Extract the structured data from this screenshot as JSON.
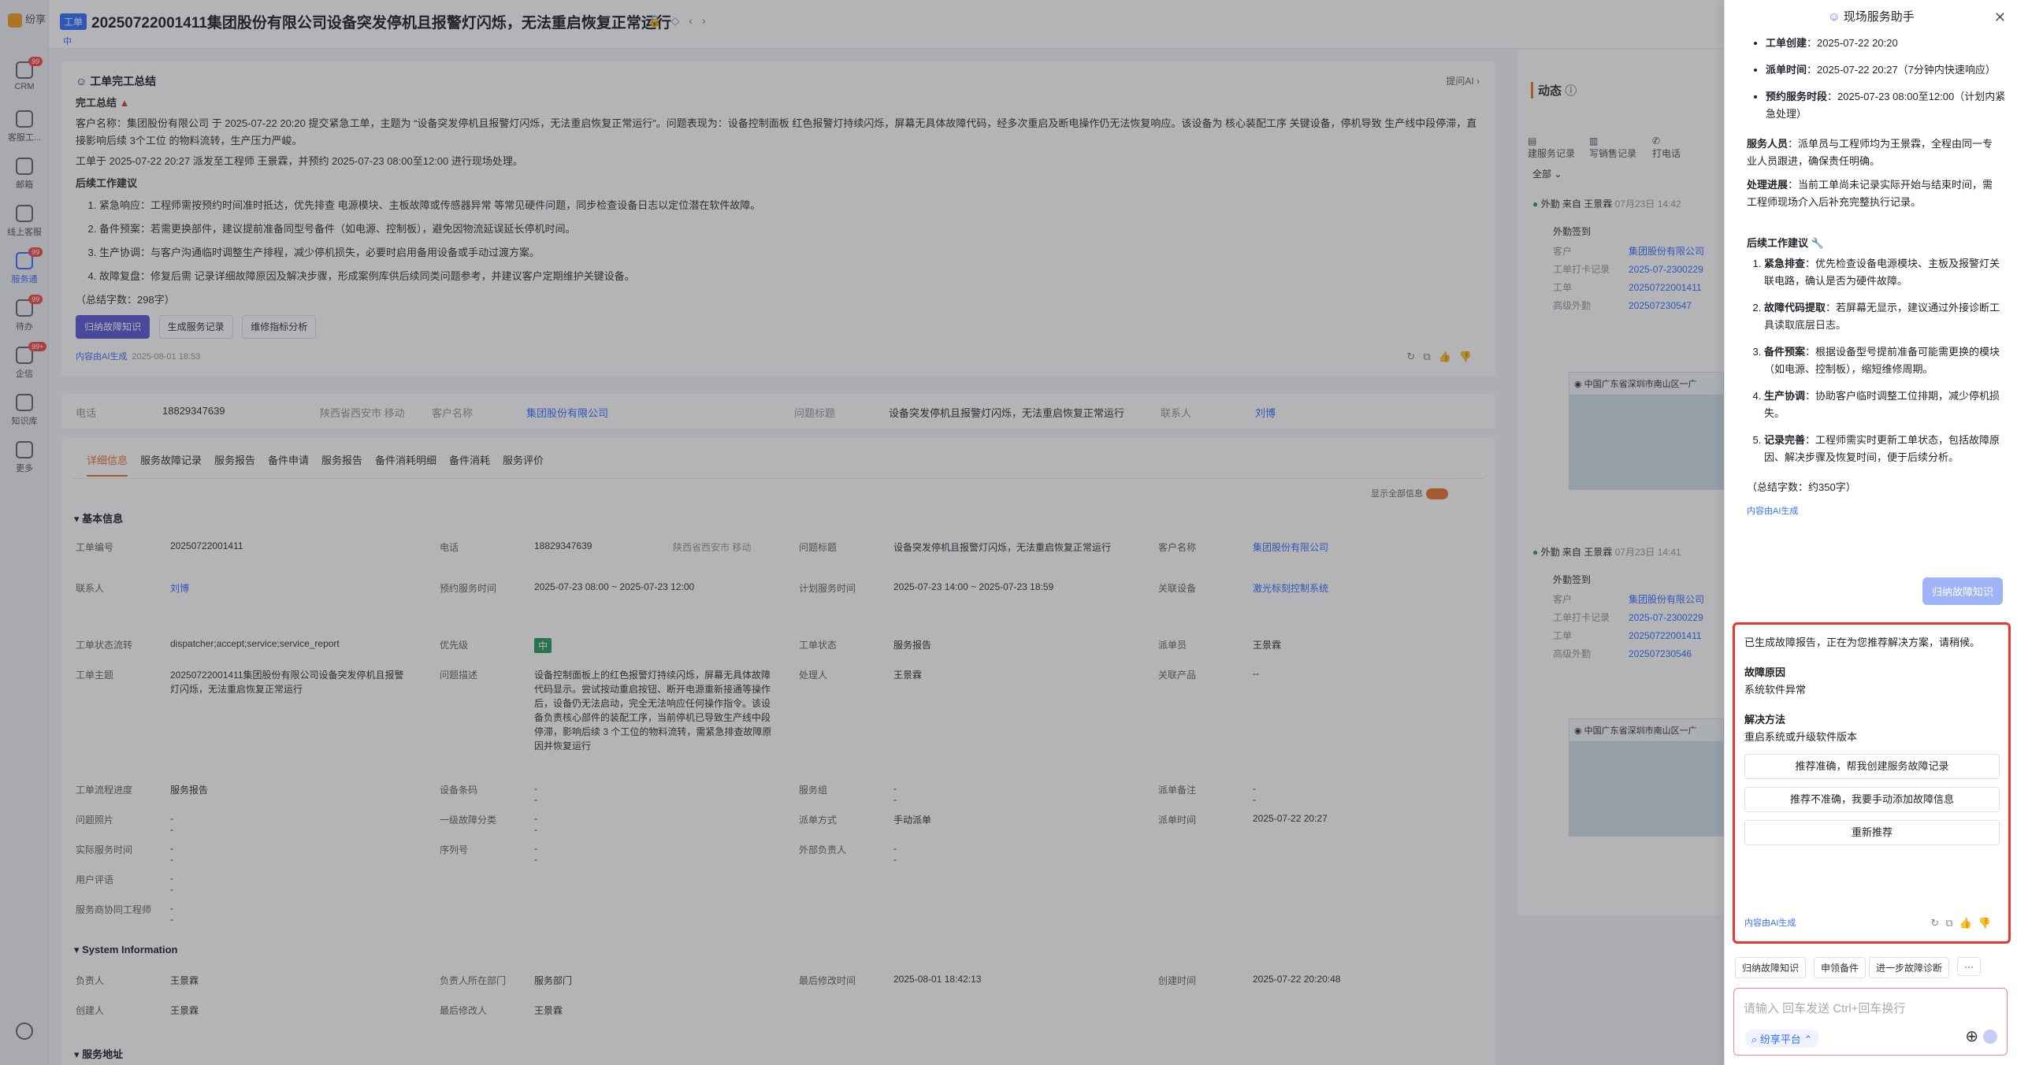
{
  "nav": {
    "logo": "纷享",
    "items": [
      {
        "label": "CRM",
        "badge": "99"
      },
      {
        "label": "客服工...",
        "badge": ""
      },
      {
        "label": "邮箱",
        "badge": ""
      },
      {
        "label": "线上客服",
        "badge": ""
      },
      {
        "label": "服务通",
        "badge": "99"
      },
      {
        "label": "待办",
        "badge": "99"
      },
      {
        "label": "企信",
        "badge": "99+"
      },
      {
        "label": "知识库",
        "badge": ""
      },
      {
        "label": "更多",
        "badge": ""
      }
    ]
  },
  "header": {
    "tag": "工单",
    "title": "20250722001411集团股份有限公司设备突发停机且报警灯闪烁，无法重启恢复正常运行",
    "subtag": "中"
  },
  "summary": {
    "head": "工单完工总结",
    "ask_ai": "提问AI",
    "sub_title": "完工总结",
    "p1": "客户名称：集团股份有限公司 于 2025-07-22 20:20 提交紧急工单，主题为 “设备突发停机且报警灯闪烁，无法重启恢复正常运行”。问题表现为：设备控制面板 红色报警灯持续闪烁，屏幕无具体故障代码，经多次重启及断电操作仍无法恢复响应。该设备为 核心装配工序 关键设备，停机导致 生产线中段停滞，直接影响后续 3个工位 的物料流转，生产压力严峻。",
    "p2": "工单于 2025-07-22 20:27 派发至工程师 王景霖，并预约 2025-07-23 08:00至12:00 进行现场处理。",
    "follow_title": "后续工作建议",
    "items": [
      "紧急响应：工程师需按预约时间准时抵达，优先排查 电源模块、主板故障或传感器异常 等常见硬件问题，同步检查设备日志以定位潜在软件故障。",
      "备件预案：若需更换部件，建议提前准备同型号备件（如电源、控制板），避免因物流延误延长停机时间。",
      "生产协调：与客户沟通临时调整生产排程，减少停机损失，必要时启用备用设备或手动过渡方案。",
      "故障复盘：修复后需 记录详细故障原因及解决步骤，形成案例库供后续同类问题参考，并建议客户定期维护关键设备。"
    ],
    "word_count": "（总结字数：298字）",
    "buttons": [
      "归纳故障知识",
      "生成服务记录",
      "维修指标分析"
    ],
    "ai_gen": "内容由AI生成",
    "ai_time": "2025-08-01 18:53"
  },
  "contact": {
    "phone_label": "电话",
    "phone": "18829347639",
    "location": "陕西省西安市 移动",
    "customer_label": "客户名称",
    "customer": "集团股份有限公司",
    "issue_label": "问题标题",
    "issue": "设备突发停机且报警灯闪烁，无法重启恢复正常运行",
    "person_label": "联系人",
    "person": "刘博"
  },
  "tabs": [
    "详细信息",
    "服务故障记录",
    "服务报告",
    "备件申请",
    "服务报告",
    "备件消耗明细",
    "备件消耗",
    "服务评价"
  ],
  "toggle_label": "显示全部信息",
  "basic": {
    "title": "基本信息",
    "fields": [
      {
        "label": "工单编号",
        "value": "20250722001411"
      },
      {
        "label": "电话",
        "value": "18829347639",
        "extra": "陕西省西安市 移动"
      },
      {
        "label": "问题标题",
        "value": "设备突发停机且报警灯闪烁，无法重启恢复正常运行"
      },
      {
        "label": "客户名称",
        "value": "集团股份有限公司"
      },
      {
        "label": "联系人",
        "value": "刘博"
      },
      {
        "label": "预约服务时间",
        "value": "2025-07-23 08:00 ~ 2025-07-23 12:00"
      },
      {
        "label": "计划服务时间",
        "value": "2025-07-23 14:00 ~ 2025-07-23 18:59"
      },
      {
        "label": "关联设备",
        "value": "激光标刻控制系统"
      },
      {
        "label": "工单状态流转",
        "value": "dispatcher;accept;service;service_report"
      },
      {
        "label": "优先级",
        "value": "中"
      },
      {
        "label": "工单状态",
        "value": "服务报告"
      },
      {
        "label": "派单员",
        "value": "王景霖"
      },
      {
        "label": "工单主题",
        "value": "20250722001411集团股份有限公司设备突发停机且报警灯闪烁，无法重启恢复正常运行"
      },
      {
        "label": "问题描述",
        "value": "设备控制面板上的红色报警灯持续闪烁，屏幕无具体故障代码显示。尝试按动重启按钮、断开电源重新接通等操作后，设备仍无法启动，完全无法响应任何操作指令。该设备负责核心部件的装配工序，当前停机已导致生产线中段停滞，影响后续 3 个工位的物料流转，需紧急排查故障原因并恢复运行"
      },
      {
        "label": "处理人",
        "value": "王景霖"
      },
      {
        "label": "关联产品",
        "value": "--"
      },
      {
        "label": "工单流程进度",
        "value": "服务报告"
      },
      {
        "label": "设备条码",
        "value": "--"
      },
      {
        "label": "服务组",
        "value": "--"
      },
      {
        "label": "派单备注",
        "value": "--"
      },
      {
        "label": "问题照片",
        "value": "--"
      },
      {
        "label": "一级故障分类",
        "value": "--"
      },
      {
        "label": "派单方式",
        "value": "手动派单"
      },
      {
        "label": "派单时间",
        "value": "2025-07-22 20:27"
      },
      {
        "label": "实际服务时间",
        "value": "--"
      },
      {
        "label": "序列号",
        "value": "--"
      },
      {
        "label": "外部负责人",
        "value": "--"
      },
      {
        "label": "用户评语",
        "value": "--"
      },
      {
        "label": "服务商协同工程师",
        "value": "--"
      }
    ]
  },
  "system": {
    "title": "System Information",
    "fields": [
      {
        "label": "负责人",
        "value": "王景霖"
      },
      {
        "label": "负责人所在部门",
        "value": "服务部门"
      },
      {
        "label": "最后修改时间",
        "value": "2025-08-01 18:42:13"
      },
      {
        "label": "创建时间",
        "value": "2025-07-22 20:20:48"
      },
      {
        "label": "创建人",
        "value": "王景霖"
      },
      {
        "label": "最后修改人",
        "value": "王景霖"
      }
    ]
  },
  "address_title": "服务地址",
  "dynamics": {
    "title": "动态",
    "tools": [
      "建服务记录",
      "写销售记录",
      "打电话"
    ],
    "filter": "全部",
    "entries": [
      {
        "head": "外勤 来自 王景霖",
        "time": "07月23日 14:42",
        "type": "外勤签到",
        "customer": "集团股份有限公司",
        "punch": "2025-07-2300229",
        "order": "20250722001411",
        "advanced": "202507230547",
        "map_addr": "中国广东省深圳市南山区一广"
      },
      {
        "head": "外勤 来自 王景霖",
        "time": "07月23日 14:41",
        "type": "外勤签到",
        "customer": "集团股份有限公司",
        "punch": "2025-07-2300229",
        "order": "20250722001411",
        "advanced": "202507230546",
        "map_addr": "中国广东省深圳市南山区一广"
      }
    ],
    "labels": {
      "customer": "客户",
      "punch": "工单打卡记录",
      "order": "工单",
      "advanced": "高级外勤"
    }
  },
  "assistant": {
    "title": "现场服务助手",
    "info": [
      {
        "k": "工单创建",
        "v": "2025-07-22 20:20"
      },
      {
        "k": "派单时间",
        "v": "2025-07-22 20:27（7分钟内快速响应）"
      },
      {
        "k": "预约服务时段",
        "v": "2025-07-23 08:00至12:00（计划内紧急处理）"
      }
    ],
    "staff_k": "服务人员",
    "staff_v": "派单员与工程师均为王景霖，全程由同一专业人员跟进，确保责任明确。",
    "progress_k": "处理进展",
    "progress_v": "当前工单尚未记录实际开始与结束时间，需工程师现场介入后补充完整执行记录。",
    "follow_title": "后续工作建议",
    "items": [
      {
        "k": "紧急排查",
        "v": "优先检查设备电源模块、主板及报警灯关联电路，确认是否为硬件故障。"
      },
      {
        "k": "故障代码提取",
        "v": "若屏幕无显示，建议通过外接诊断工具读取底层日志。"
      },
      {
        "k": "备件预案",
        "v": "根据设备型号提前准备可能需更换的模块（如电源、控制板），缩短维修周期。"
      },
      {
        "k": "生产协调",
        "v": "协助客户临时调整工位排期，减少停机损失。"
      },
      {
        "k": "记录完善",
        "v": "工程师需实时更新工单状态，包括故障原因、解决步骤及恢复时间，便于后续分析。"
      }
    ],
    "word_count": "（总结字数：约350字）",
    "ai_gen": "内容由AI生成",
    "user_msg": "归纳故障知识",
    "reply_intro": "已生成故障报告，正在为您推荐解决方案，请稍候。",
    "cause_title": "故障原因",
    "cause": "系统软件异常",
    "solution_title": "解决方法",
    "solution": "重启系统或升级软件版本",
    "choices": [
      "推荐准确，帮我创建服务故障记录",
      "推荐不准确，我要手动添加故障信息",
      "重新推荐"
    ],
    "quick": [
      "归纳故障知识",
      "申领备件",
      "进一步故障诊断",
      "···"
    ],
    "input_placeholder": "请输入 回车发送 Ctrl+回车换行",
    "platform": "纷享平台"
  }
}
